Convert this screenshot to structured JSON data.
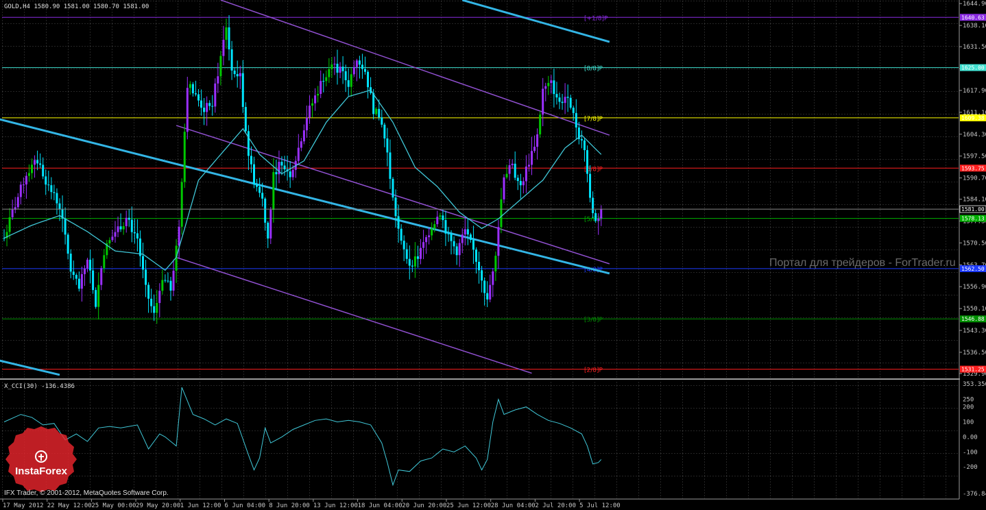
{
  "header": {
    "symbol_info": "GOLD,H4  1580.90 1581.00 1580.70 1581.00"
  },
  "indicator": {
    "label": "X_CCI(30) -136.4386",
    "axis_ticks": [
      "353.356",
      "250",
      "200",
      "100",
      "0.00",
      "-100",
      "-200",
      "-376.847"
    ],
    "axis_values": [
      353.356,
      250,
      200,
      100,
      0,
      -100,
      -200,
      -376.847
    ]
  },
  "watermark": {
    "text": "Портал для трейдеров - ForTrader.ru",
    "brand": "InstaForex",
    "copyright": "IFX Trader, © 2001-2012, MetaQuotes Software Corp."
  },
  "colors": {
    "bull": "#9b30ff",
    "bear": "#00e5ff",
    "bull_green": "#00c800",
    "ma": "#40c8d8",
    "channel_blue": "#33b5e5",
    "channel_purple": "#9050d0",
    "grid": "#5a5a5a",
    "axis_text": "#c8c8c8"
  },
  "price_axis": {
    "ticks": [
      "1644.90",
      "1638.10",
      "1631.50",
      "1624.70",
      "1617.90",
      "1611.10",
      "1604.30",
      "1597.50",
      "1590.70",
      "1584.10",
      "1577.30",
      "1570.50",
      "1563.70",
      "1556.90",
      "1550.10",
      "1543.30",
      "1536.50",
      "1529.90"
    ],
    "current_price": "1581.00"
  },
  "levels": [
    {
      "name": "[+1/8]P",
      "axis_label": "1640.63",
      "price": 1640.63,
      "color": "#8a2be2"
    },
    {
      "name": "[8/8]P",
      "axis_label": "1625.00",
      "price": 1625.0,
      "color": "#40e0d0"
    },
    {
      "name": "[7/8]P",
      "axis_label": "1609.38",
      "price": 1609.38,
      "color": "#ffff00"
    },
    {
      "name": "[6/8]P",
      "axis_label": "1593.75",
      "price": 1593.75,
      "color": "#ff2020"
    },
    {
      "name": "[5/8]P",
      "axis_label": "1578.13",
      "price": 1578.13,
      "color": "#00b000"
    },
    {
      "name": "[4/8]P",
      "axis_label": "1562.50",
      "price": 1562.5,
      "color": "#1e3cff"
    },
    {
      "name": "[3/8]P",
      "axis_label": "1546.88",
      "price": 1546.88,
      "color": "#009000"
    },
    {
      "name": "[2/8]P",
      "axis_label": "1531.25",
      "price": 1531.25,
      "color": "#ff2020"
    }
  ],
  "time_axis": [
    "17 May 2012",
    "22 May 12:00",
    "25 May 00:00",
    "29 May 20:00",
    "1 Jun 12:00",
    "6 Jun 04:00",
    "8 Jun 20:00",
    "13 Jun 12:00",
    "18 Jun 04:00",
    "20 Jun 20:00",
    "25 Jun 12:00",
    "28 Jun 04:00",
    "2 Jul 20:00",
    "5 Jul 12:00"
  ],
  "chart_data": {
    "type": "candlestick",
    "symbol": "GOLD",
    "timeframe": "H4",
    "ylim": [
      1528.6,
      1645.8
    ],
    "price_path": [
      [
        0,
        1572
      ],
      [
        3,
        1580
      ],
      [
        8,
        1592
      ],
      [
        12,
        1596
      ],
      [
        16,
        1588
      ],
      [
        20,
        1582
      ],
      [
        24,
        1562
      ],
      [
        27,
        1556
      ],
      [
        30,
        1566
      ],
      [
        33,
        1552
      ],
      [
        36,
        1568
      ],
      [
        40,
        1574
      ],
      [
        44,
        1578
      ],
      [
        48,
        1572
      ],
      [
        51,
        1556
      ],
      [
        54,
        1548
      ],
      [
        57,
        1560
      ],
      [
        60,
        1556
      ],
      [
        63,
        1576
      ],
      [
        66,
        1620
      ],
      [
        69,
        1616
      ],
      [
        72,
        1612
      ],
      [
        75,
        1614
      ],
      [
        78,
        1628
      ],
      [
        80,
        1638
      ],
      [
        82,
        1624
      ],
      [
        85,
        1622
      ],
      [
        88,
        1598
      ],
      [
        90,
        1590
      ],
      [
        93,
        1584
      ],
      [
        95,
        1572
      ],
      [
        97,
        1592
      ],
      [
        100,
        1596
      ],
      [
        103,
        1592
      ],
      [
        106,
        1600
      ],
      [
        109,
        1610
      ],
      [
        112,
        1616
      ],
      [
        115,
        1622
      ],
      [
        118,
        1626
      ],
      [
        121,
        1624
      ],
      [
        124,
        1620
      ],
      [
        127,
        1628
      ],
      [
        130,
        1624
      ],
      [
        133,
        1612
      ],
      [
        136,
        1608
      ],
      [
        138,
        1598
      ],
      [
        140,
        1584
      ],
      [
        143,
        1570
      ],
      [
        146,
        1564
      ],
      [
        149,
        1566
      ],
      [
        151,
        1570
      ],
      [
        154,
        1576
      ],
      [
        157,
        1580
      ],
      [
        160,
        1572
      ],
      [
        163,
        1568
      ],
      [
        166,
        1574
      ],
      [
        169,
        1568
      ],
      [
        172,
        1560
      ],
      [
        174,
        1552
      ],
      [
        177,
        1568
      ],
      [
        180,
        1592
      ],
      [
        183,
        1594
      ],
      [
        186,
        1588
      ],
      [
        189,
        1596
      ],
      [
        192,
        1604
      ],
      [
        194,
        1618
      ],
      [
        197,
        1620
      ],
      [
        200,
        1614
      ],
      [
        203,
        1617
      ],
      [
        205,
        1610
      ],
      [
        207,
        1604
      ],
      [
        209,
        1600
      ],
      [
        211,
        1584
      ],
      [
        213,
        1577
      ],
      [
        215,
        1581
      ]
    ],
    "ma_path": [
      [
        0,
        1572
      ],
      [
        10,
        1576
      ],
      [
        20,
        1579
      ],
      [
        30,
        1574
      ],
      [
        40,
        1568
      ],
      [
        50,
        1567
      ],
      [
        58,
        1562
      ],
      [
        62,
        1566
      ],
      [
        70,
        1590
      ],
      [
        80,
        1600
      ],
      [
        86,
        1606
      ],
      [
        92,
        1598
      ],
      [
        100,
        1592
      ],
      [
        108,
        1596
      ],
      [
        116,
        1608
      ],
      [
        124,
        1616
      ],
      [
        132,
        1618
      ],
      [
        140,
        1608
      ],
      [
        148,
        1594
      ],
      [
        156,
        1588
      ],
      [
        164,
        1580
      ],
      [
        172,
        1575
      ],
      [
        178,
        1578
      ],
      [
        186,
        1584
      ],
      [
        194,
        1590
      ],
      [
        202,
        1600
      ],
      [
        208,
        1604
      ],
      [
        215,
        1598
      ]
    ],
    "cci_path": [
      [
        0,
        100
      ],
      [
        6,
        150
      ],
      [
        10,
        130
      ],
      [
        14,
        80
      ],
      [
        18,
        90
      ],
      [
        22,
        -20
      ],
      [
        26,
        20
      ],
      [
        30,
        -30
      ],
      [
        34,
        60
      ],
      [
        38,
        70
      ],
      [
        42,
        60
      ],
      [
        48,
        80
      ],
      [
        52,
        -80
      ],
      [
        56,
        20
      ],
      [
        58,
        0
      ],
      [
        62,
        -60
      ],
      [
        64,
        330
      ],
      [
        68,
        150
      ],
      [
        72,
        120
      ],
      [
        76,
        80
      ],
      [
        80,
        120
      ],
      [
        84,
        90
      ],
      [
        88,
        -120
      ],
      [
        90,
        -220
      ],
      [
        92,
        -140
      ],
      [
        94,
        60
      ],
      [
        96,
        -40
      ],
      [
        100,
        0
      ],
      [
        104,
        50
      ],
      [
        108,
        80
      ],
      [
        112,
        110
      ],
      [
        116,
        120
      ],
      [
        120,
        100
      ],
      [
        124,
        110
      ],
      [
        128,
        100
      ],
      [
        132,
        80
      ],
      [
        136,
        -40
      ],
      [
        138,
        -170
      ],
      [
        140,
        -320
      ],
      [
        142,
        -220
      ],
      [
        146,
        -230
      ],
      [
        150,
        -160
      ],
      [
        154,
        -140
      ],
      [
        158,
        -80
      ],
      [
        162,
        -100
      ],
      [
        166,
        -60
      ],
      [
        170,
        -140
      ],
      [
        172,
        -220
      ],
      [
        174,
        -150
      ],
      [
        176,
        100
      ],
      [
        178,
        250
      ],
      [
        180,
        150
      ],
      [
        184,
        180
      ],
      [
        188,
        200
      ],
      [
        192,
        150
      ],
      [
        196,
        110
      ],
      [
        200,
        90
      ],
      [
        204,
        60
      ],
      [
        208,
        20
      ],
      [
        210,
        -60
      ],
      [
        212,
        -180
      ],
      [
        214,
        -170
      ],
      [
        215,
        -150
      ]
    ],
    "channels": [
      {
        "color": "channel_blue",
        "width": 3,
        "from": [
          -2,
          1609
        ],
        "to": [
          218,
          1561
        ]
      },
      {
        "color": "channel_blue",
        "width": 3,
        "from": [
          -2,
          1534
        ],
        "to": [
          20,
          1529.5
        ]
      },
      {
        "color": "channel_blue",
        "width": 3,
        "from": [
          165,
          1646
        ],
        "to": [
          218,
          1633
        ]
      },
      {
        "color": "channel_purple",
        "width": 1.5,
        "from": [
          62,
          1607
        ],
        "to": [
          218,
          1564
        ]
      },
      {
        "color": "channel_purple",
        "width": 1.5,
        "from": [
          62,
          1566
        ],
        "to": [
          190,
          1530
        ]
      },
      {
        "color": "channel_purple",
        "width": 1.5,
        "from": [
          78,
          1646
        ],
        "to": [
          218,
          1604
        ]
      }
    ]
  }
}
